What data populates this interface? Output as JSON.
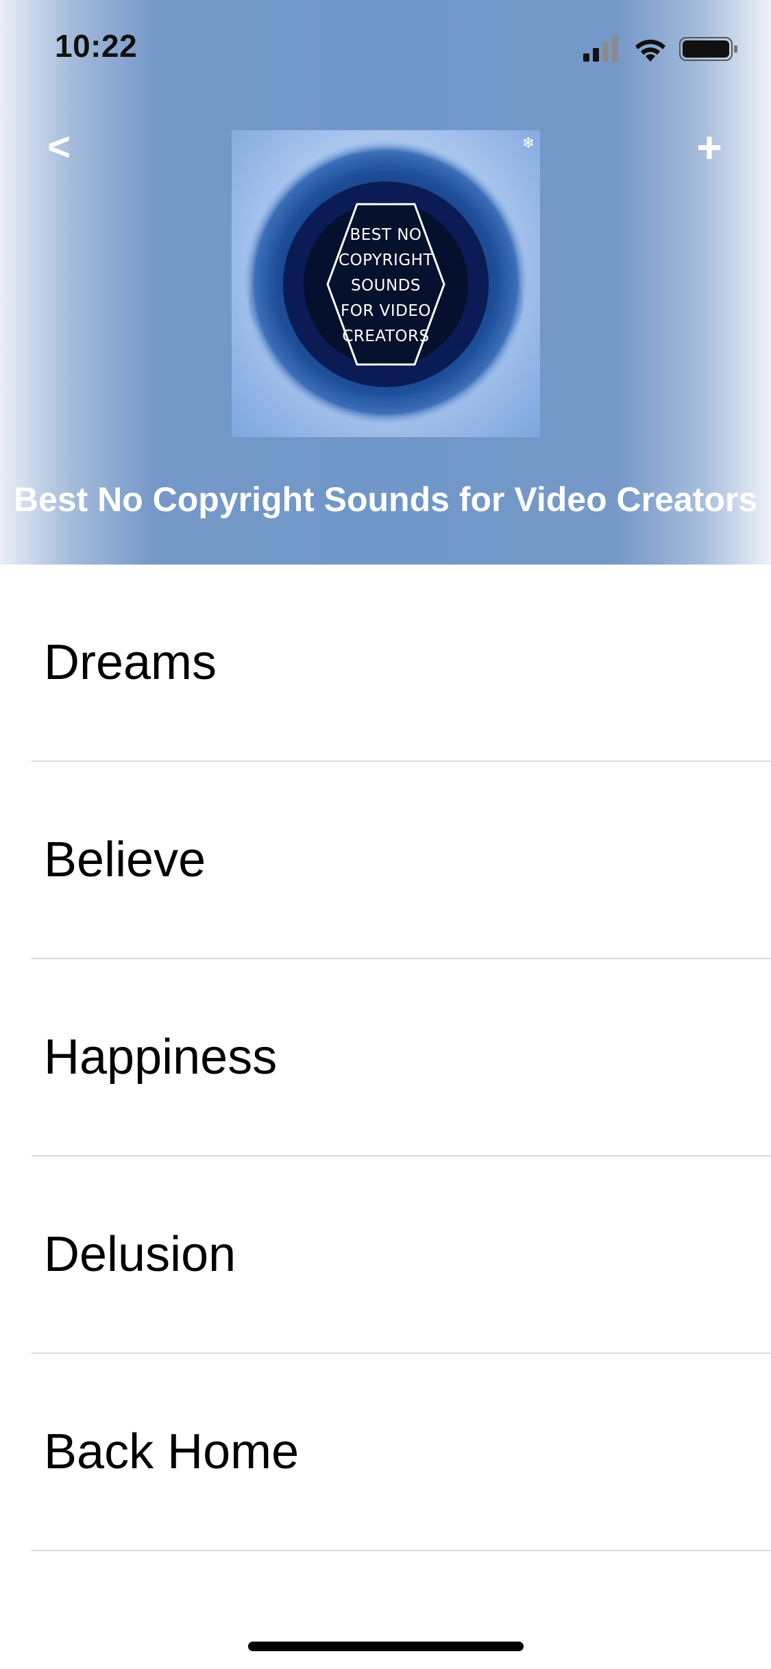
{
  "status_bar": {
    "time": "10:22"
  },
  "header": {
    "back_icon": "<",
    "add_icon": "+",
    "title": "Best No Copyright Sounds for Video Creators",
    "background_color": "#7097c8"
  },
  "album_art": {
    "lines": [
      "BEST NO",
      "COPYRIGHT",
      "SOUNDS",
      "FOR VIDEO",
      "CREATORS"
    ]
  },
  "tracks": [
    {
      "title": "Dreams"
    },
    {
      "title": "Believe"
    },
    {
      "title": "Happiness"
    },
    {
      "title": "Delusion"
    },
    {
      "title": "Back Home"
    }
  ],
  "icons": {
    "signal": "signal-icon",
    "wifi": "wifi-icon",
    "battery": "battery-icon",
    "back": "back-icon",
    "add": "add-icon"
  }
}
